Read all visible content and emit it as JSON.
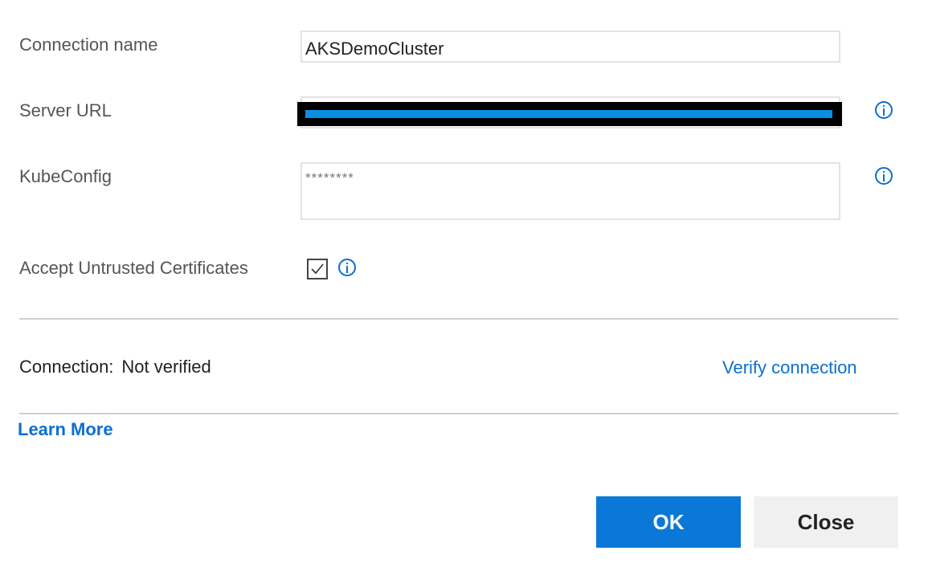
{
  "form": {
    "connection_name": {
      "label": "Connection name",
      "value": "AKSDemoCluster"
    },
    "server_url": {
      "label": "Server URL"
    },
    "kubeconfig": {
      "label": "KubeConfig",
      "value": "********"
    },
    "accept_untrusted": {
      "label": "Accept Untrusted Certificates",
      "checked": true
    }
  },
  "connection": {
    "prefix": "Connection:",
    "status": "Not verified",
    "verify_label": "Verify connection"
  },
  "links": {
    "learn_more": "Learn More"
  },
  "buttons": {
    "ok": "OK",
    "close": "Close"
  },
  "icons": {
    "info": "info-icon",
    "check": "checkmark-icon"
  },
  "colors": {
    "accent": "#0b78d7",
    "link": "#0b6fd1",
    "secondary_button": "#f0f0f0"
  }
}
